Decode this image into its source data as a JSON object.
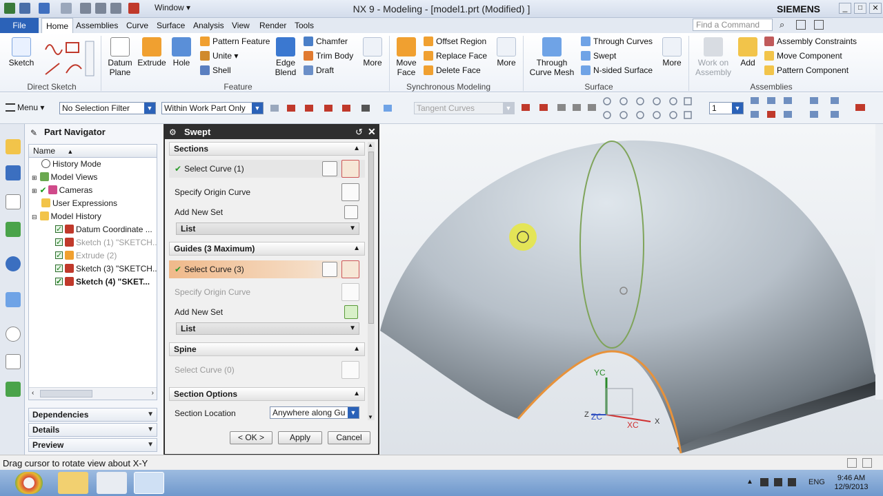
{
  "window": {
    "title": "NX 9 - Modeling - [model1.prt (Modified) ]",
    "brand": "SIEMENS",
    "menu_label": "Window"
  },
  "tabs": [
    "File",
    "Home",
    "Assemblies",
    "Curve",
    "Surface",
    "Analysis",
    "View",
    "Render",
    "Tools"
  ],
  "command_search": {
    "placeholder": "Find a Command"
  },
  "ribbon": {
    "sketch": "Sketch",
    "direct_sketch": "Direct Sketch",
    "datum_plane": "Datum Plane",
    "extrude": "Extrude",
    "hole": "Hole",
    "pattern_feature": "Pattern Feature",
    "unite": "Unite",
    "shell": "Shell",
    "edge_blend": "Edge Blend",
    "chamfer": "Chamfer",
    "trim_body": "Trim Body",
    "draft": "Draft",
    "more": "More",
    "feature": "Feature",
    "move_face": "Move Face",
    "offset_region": "Offset Region",
    "replace_face": "Replace Face",
    "delete_face": "Delete Face",
    "synchronous_modeling": "Synchronous Modeling",
    "through_curve_mesh": "Through Curve Mesh",
    "through_curves": "Through Curves",
    "swept": "Swept",
    "n_sided_surface": "N-sided Surface",
    "surface": "Surface",
    "work_on_assembly": "Work on Assembly",
    "add": "Add",
    "assembly_constraints": "Assembly Constraints",
    "move_component": "Move Component",
    "pattern_component": "Pattern Component",
    "assemblies": "Assemblies"
  },
  "toolbar": {
    "menu": "Menu",
    "selection_filter": "No Selection Filter",
    "scope": "Within Work Part Only",
    "curve_rule": "Tangent Curves",
    "layer": "1"
  },
  "navigator": {
    "title": "Part Navigator",
    "column": "Name",
    "items": [
      {
        "label": "History Mode"
      },
      {
        "label": "Model Views"
      },
      {
        "label": "Cameras"
      },
      {
        "label": "User Expressions"
      },
      {
        "label": "Model History"
      },
      {
        "label": "Datum Coordinate ..."
      },
      {
        "label": "Sketch (1) \"SKETCH..."
      },
      {
        "label": "Extrude (2)"
      },
      {
        "label": "Sketch (3) \"SKETCH..."
      },
      {
        "label": "Sketch (4) \"SKET..."
      }
    ],
    "panels": [
      "Dependencies",
      "Details",
      "Preview"
    ]
  },
  "dialog": {
    "title": "Swept",
    "sections_header": "Sections",
    "sections_select": "Select Curve (1)",
    "sections_origin": "Specify Origin Curve",
    "sections_add": "Add New Set",
    "sections_list": "List",
    "guides_header": "Guides (3 Maximum)",
    "guides_select": "Select Curve (3)",
    "guides_origin": "Specify Origin Curve",
    "guides_add": "Add New Set",
    "guides_list": "List",
    "spine_header": "Spine",
    "spine_select": "Select Curve (0)",
    "options_header": "Section Options",
    "section_location": "Section Location",
    "section_location_value": "Anywhere along Gu",
    "ok": "< OK >",
    "apply": "Apply",
    "cancel": "Cancel"
  },
  "viewport": {
    "axis_y": "YC",
    "axis_z": "ZC",
    "axis_x": "XC",
    "x": "X",
    "z": "Z"
  },
  "status": "Drag cursor to rotate view about X-Y",
  "taskbar": {
    "lang": "ENG",
    "time": "9:46 AM",
    "date": "12/9/2013"
  }
}
